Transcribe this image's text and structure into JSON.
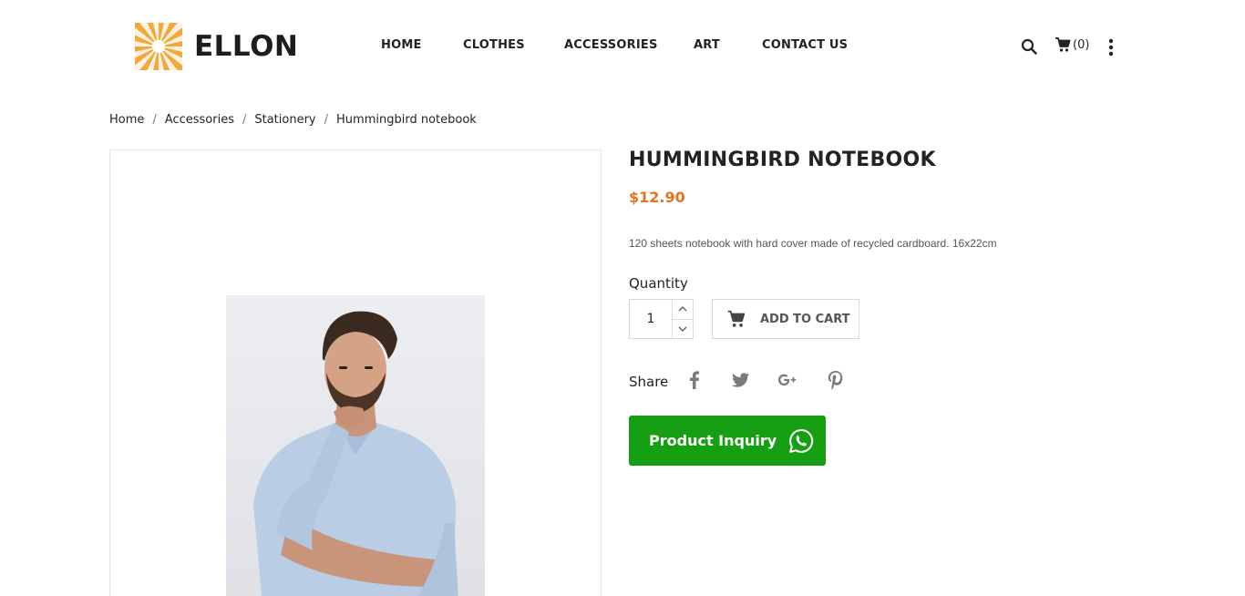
{
  "brand": {
    "name": "ELLON",
    "accent_color": "#f0a93a"
  },
  "nav": {
    "items": [
      {
        "label": "HOME"
      },
      {
        "label": "CLOTHES"
      },
      {
        "label": "ACCESSORIES"
      },
      {
        "label": "ART"
      },
      {
        "label": "CONTACT US"
      }
    ]
  },
  "header": {
    "cart_count": "(0)",
    "icons": [
      "search-icon",
      "cart-icon",
      "more-icon"
    ]
  },
  "breadcrumb": {
    "items": [
      {
        "label": "Home"
      },
      {
        "label": "Accessories"
      },
      {
        "label": "Stationery"
      },
      {
        "label": "Hummingbird notebook"
      }
    ],
    "separator": "/"
  },
  "product": {
    "title": "HUMMINGBIRD NOTEBOOK",
    "price": "$12.90",
    "price_color": "#e8731e",
    "description": "120 sheets notebook with hard cover made of recycled cardboard. 16x22cm",
    "quantity_label": "Quantity",
    "quantity_value": "1",
    "add_to_cart_label": "ADD TO CART",
    "share_label": "Share",
    "share_icons": [
      "facebook-icon",
      "twitter-icon",
      "google-plus-icon",
      "pinterest-icon"
    ],
    "inquiry_label": "Product Inquiry",
    "inquiry_color": "#169f12"
  }
}
